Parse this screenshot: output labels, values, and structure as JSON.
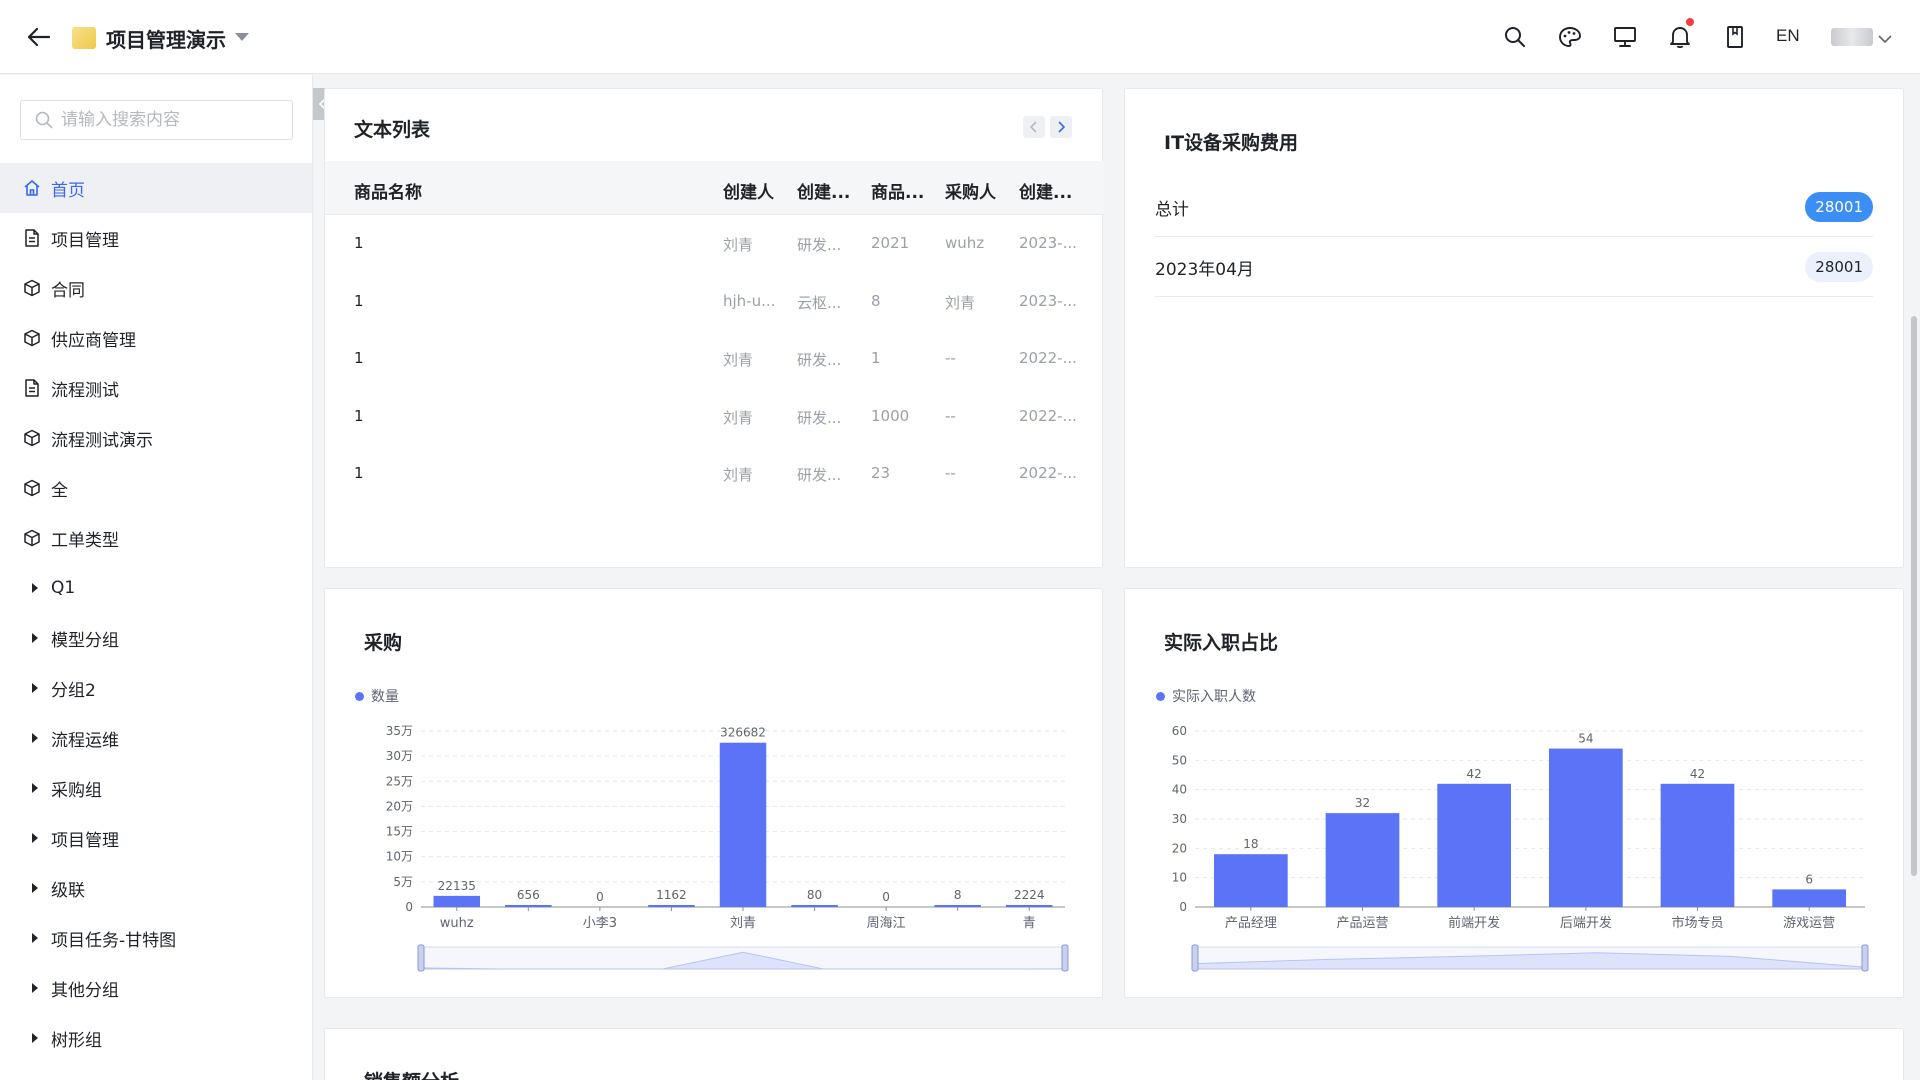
{
  "header": {
    "project_title": "项目管理演示",
    "lang": "EN"
  },
  "sidebar": {
    "search_placeholder": "请输入搜索内容",
    "items": [
      {
        "label": "首页",
        "icon": "home-icon",
        "kind": "icon",
        "active": true
      },
      {
        "label": "项目管理",
        "icon": "document-icon",
        "kind": "icon"
      },
      {
        "label": "合同",
        "icon": "cube-icon",
        "kind": "icon"
      },
      {
        "label": "供应商管理",
        "icon": "cube-icon",
        "kind": "icon"
      },
      {
        "label": "流程测试",
        "icon": "document-icon",
        "kind": "icon"
      },
      {
        "label": "流程测试演示",
        "icon": "cube-icon",
        "kind": "icon"
      },
      {
        "label": "全",
        "icon": "cube-icon",
        "kind": "icon"
      },
      {
        "label": "工单类型",
        "icon": "cube-icon",
        "kind": "icon"
      },
      {
        "label": "Q1",
        "kind": "group"
      },
      {
        "label": "模型分组",
        "kind": "group"
      },
      {
        "label": "分组2",
        "kind": "group"
      },
      {
        "label": "流程运维",
        "kind": "group"
      },
      {
        "label": "采购组",
        "kind": "group"
      },
      {
        "label": "项目管理",
        "kind": "group"
      },
      {
        "label": "级联",
        "kind": "group"
      },
      {
        "label": "项目任务-甘特图",
        "kind": "group"
      },
      {
        "label": "其他分组",
        "kind": "group"
      },
      {
        "label": "树形组",
        "kind": "group"
      }
    ]
  },
  "text_list": {
    "title": "文本列表",
    "columns": [
      "商品名称",
      "创建人",
      "创建...",
      "商品...",
      "采购人",
      "创建..."
    ],
    "rows": [
      [
        "1",
        "刘青",
        "研发...",
        "2021",
        "wuhz",
        "2023-..."
      ],
      [
        "1",
        "hjh-u...",
        "云枢...",
        "8",
        "刘青",
        "2023-..."
      ],
      [
        "1",
        "刘青",
        "研发...",
        "1",
        "--",
        "2022-..."
      ],
      [
        "1",
        "刘青",
        "研发...",
        "1000",
        "--",
        "2022-..."
      ],
      [
        "1",
        "刘青",
        "研发...",
        "23",
        "--",
        "2022-..."
      ]
    ]
  },
  "it_cost": {
    "title": "IT设备采购费用",
    "rows": [
      {
        "label": "总计",
        "value": "28001",
        "highlight": true
      },
      {
        "label": "2023年04月",
        "value": "28001",
        "highlight": false
      }
    ]
  },
  "purchase_chart": {
    "title": "采购",
    "legend": "数量",
    "y_tick_labels": [
      "0",
      "5万",
      "10万",
      "15万",
      "20万",
      "25万",
      "30万",
      "35万"
    ],
    "x_axis_labels": [
      "wuhz",
      "小李3",
      "刘青",
      "周海江",
      "青"
    ]
  },
  "onboard_chart": {
    "title": "实际入职占比",
    "legend": "实际入职人数",
    "y_tick_labels": [
      "0",
      "10",
      "20",
      "30",
      "40",
      "50",
      "60"
    ]
  },
  "sales": {
    "title": "销售额分析"
  },
  "chart_data": [
    {
      "type": "bar",
      "title": "采购",
      "series": [
        {
          "name": "数量",
          "values": [
            22135,
            656,
            0,
            1162,
            326682,
            80,
            0,
            8,
            2224
          ]
        }
      ],
      "categories": [
        "wuhz",
        "",
        "小李3",
        "",
        "刘青",
        "",
        "周海江",
        "",
        "青"
      ],
      "ylim": [
        0,
        350000
      ],
      "grid": true,
      "legend_position": "top-left",
      "color": "#5b73f6"
    },
    {
      "type": "bar",
      "title": "实际入职占比",
      "series": [
        {
          "name": "实际入职人数",
          "values": [
            18,
            32,
            42,
            54,
            42,
            6
          ]
        }
      ],
      "categories": [
        "产品经理",
        "产品运营",
        "前端开发",
        "后端开发",
        "市场专员",
        "游戏运营"
      ],
      "ylim": [
        0,
        60
      ],
      "grid": true,
      "legend_position": "top-left",
      "color": "#5b73f6"
    }
  ]
}
